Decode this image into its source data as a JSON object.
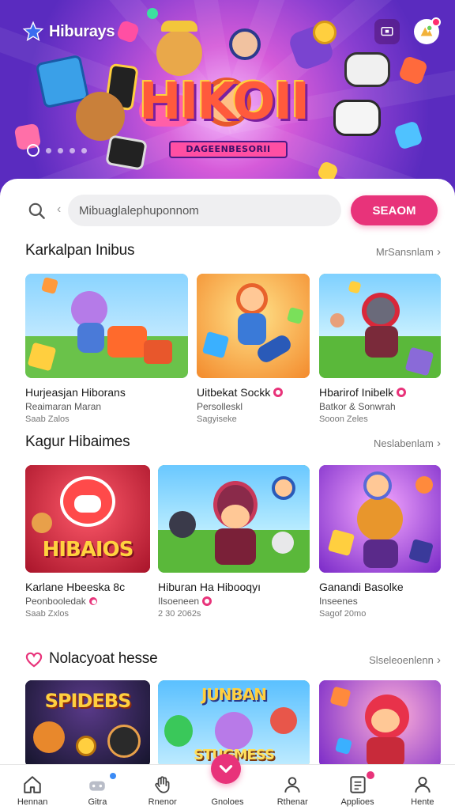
{
  "app": {
    "brand": "Hiburays"
  },
  "hero": {
    "logo_text": "HIKOII",
    "subtitle": "DAGEENBESORII",
    "pager_count": 5,
    "pager_active_index": 0,
    "icons": [
      "tv-icon",
      "avatar"
    ]
  },
  "search": {
    "placeholder": "Mibuaglalephuponnom",
    "button_label": "SEAOM"
  },
  "sections": [
    {
      "title": "Karkalpan Inibus",
      "link": "MrSansnlam",
      "cards": [
        {
          "title": "Hurjeasjan Hiborans",
          "sub": "Reaimaran Maran",
          "meta": "Saab Zalos",
          "badge": false
        },
        {
          "title": "Uitbekat Sockk",
          "sub": "Persolleskl",
          "meta": "Sagyiseke",
          "badge": true
        },
        {
          "title": "Hbarirof Inibelk",
          "sub": "Batkor & Sonwrah",
          "meta": "Sooon Zeles",
          "badge": true
        }
      ]
    },
    {
      "title": "Kagur Hibaimes",
      "link": "Neslabenlam",
      "cards": [
        {
          "title": "Karlane Hbeeska 8c",
          "sub": "Peonbooledak",
          "meta": "Saab Zxlos",
          "badge": false,
          "art_word": "HIBAIOS"
        },
        {
          "title": "Hiburan Ha Hibooqyı",
          "sub": "Ilsoeneen",
          "meta": "2 30 2062s",
          "badge": true
        },
        {
          "title": "Ganandi Basolke",
          "sub": "Inseenes",
          "meta": "Sagof 20mo",
          "badge": false
        }
      ]
    },
    {
      "title": "Nolacyoat hesse",
      "link": "Slseleoenlenn",
      "cards": [
        {
          "art_word": "SPIDEBS"
        },
        {
          "art_word": "JUNBAN",
          "art_word2": "STUGMESS"
        },
        {}
      ]
    }
  ],
  "bottom_nav": [
    {
      "label": "Hennan",
      "icon": "home-icon"
    },
    {
      "label": "Gitra",
      "icon": "gamepad-icon"
    },
    {
      "label": "Rnenor",
      "icon": "hand-icon"
    },
    {
      "label": "Gnoloes",
      "icon": "heart-icon"
    },
    {
      "label": "Rthenar",
      "icon": "user-icon"
    },
    {
      "label": "Applioes",
      "icon": "notes-icon"
    },
    {
      "label": "Hente",
      "icon": "profile-icon"
    }
  ],
  "colors": {
    "accent": "#e8337a",
    "hero_purple": "#6a2fc7",
    "text": "#1a1a1a"
  }
}
